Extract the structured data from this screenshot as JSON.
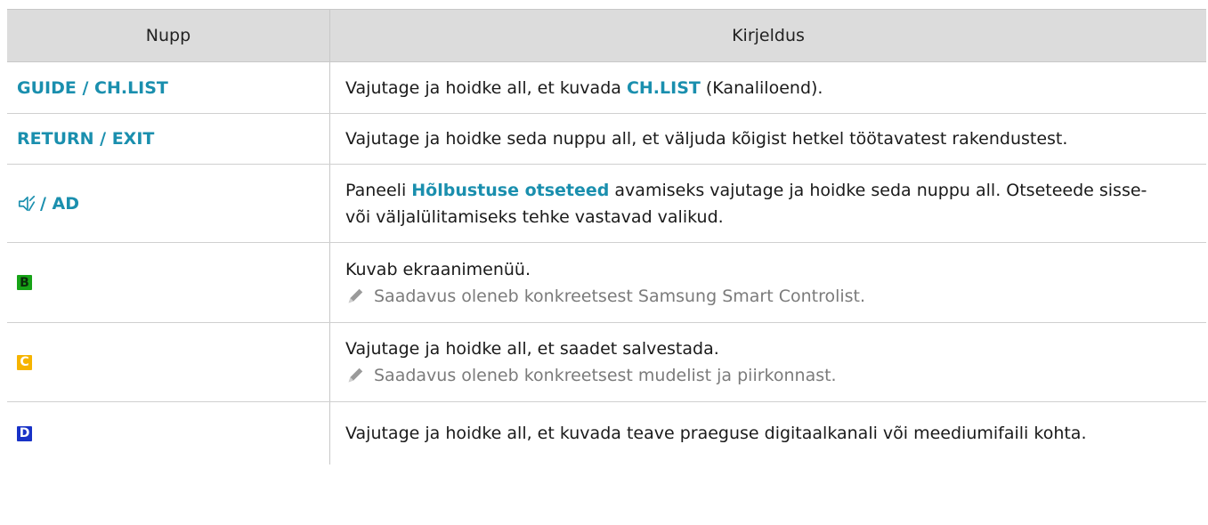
{
  "table": {
    "header": {
      "col1": "Nupp",
      "col2": "Kirjeldus"
    },
    "rows": [
      {
        "button": "GUIDE / CH.LIST",
        "desc_pre": "Vajutage ja hoidke all, et kuvada ",
        "desc_hl": "CH.LIST",
        "desc_post": " (Kanaliloend)."
      },
      {
        "button": "RETURN / EXIT",
        "desc": "Vajutage ja hoidke seda nuppu all, et väljuda kõigist hetkel töötavatest rakendustest."
      },
      {
        "button_icon": "audio-description-icon",
        "button": "/ AD",
        "desc_pre": "Paneeli ",
        "desc_hl": "Hõlbustuse otseteed",
        "desc_post": " avamiseks vajutage ja hoidke seda nuppu all. Otseteede sisse-",
        "desc_line2": "või väljalülitamiseks tehke vastavad valikud."
      },
      {
        "key_letter": "B",
        "key_color": "#17a317",
        "desc": "Kuvab ekraanimenüü.",
        "note": "Saadavus oleneb konkreetsest Samsung Smart Controlist."
      },
      {
        "key_letter": "C",
        "key_color": "#f6b400",
        "desc": "Vajutage ja hoidke all, et saadet salvestada.",
        "note": "Saadavus oleneb konkreetsest mudelist ja piirkonnast."
      },
      {
        "key_letter": "D",
        "key_color": "#1832c7",
        "desc": "Vajutage ja hoidke all, et kuvada teave praeguse digitaalkanali või meediumifaili kohta."
      }
    ]
  },
  "colors": {
    "accent": "#1a8fae",
    "header_bg": "#dcdcdc",
    "note_text": "#7b7b7b"
  },
  "icons": {
    "note": "pencil-icon"
  }
}
